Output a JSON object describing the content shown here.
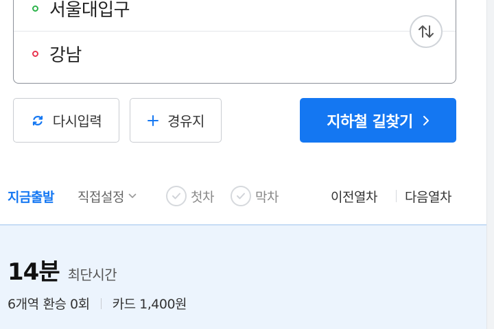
{
  "route": {
    "start": "서울대입구",
    "end": "강남"
  },
  "buttons": {
    "reset": "다시입력",
    "waypoint": "경유지",
    "search": "지하철 길찾기"
  },
  "options": {
    "now": "지금출발",
    "custom": "직접설정",
    "first": "첫차",
    "last": "막차",
    "prev": "이전열차",
    "next": "다음열차"
  },
  "result": {
    "time": "14분",
    "time_label": "최단시간",
    "stations": "6개역",
    "transfer": "환승 0회",
    "fare": "카드 1,400원"
  },
  "colors": {
    "accent": "#1477f2",
    "start_dot": "#2bb34a",
    "end_dot": "#e8344e"
  }
}
